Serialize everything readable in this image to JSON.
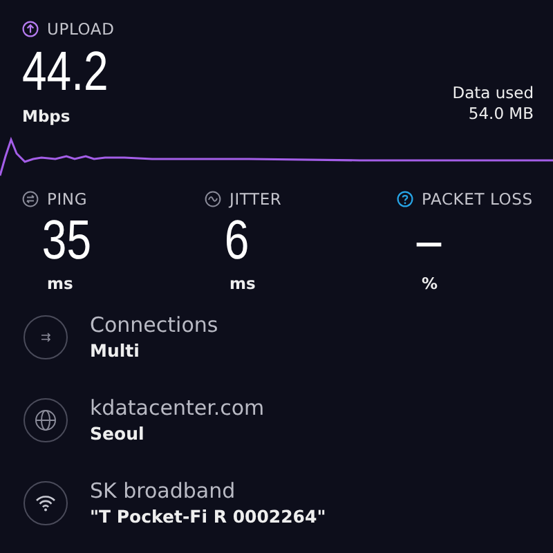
{
  "upload": {
    "label": "UPLOAD",
    "value": "44.2",
    "unit": "Mbps"
  },
  "data_used": {
    "label": "Data used",
    "value": "54.0 MB"
  },
  "metrics": [
    {
      "kind": "ping",
      "label": "PING",
      "value": "35",
      "unit": "ms"
    },
    {
      "kind": "jitter",
      "label": "JITTER",
      "value": "6",
      "unit": "ms"
    },
    {
      "kind": "help",
      "label": "PACKET LOSS",
      "value": "–",
      "unit": "%"
    }
  ],
  "details": [
    {
      "kind": "connections",
      "title": "Connections",
      "value": "Multi"
    },
    {
      "kind": "server",
      "title": "kdatacenter.com",
      "value": "Seoul"
    },
    {
      "kind": "wifi",
      "title": "SK broadband",
      "value": "\"T Pocket-Fi R 0002264\""
    }
  ]
}
